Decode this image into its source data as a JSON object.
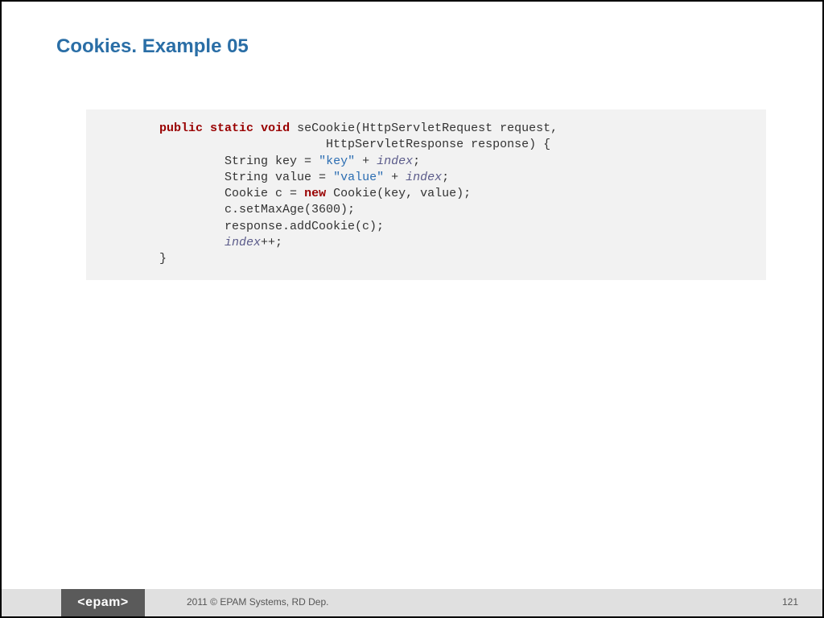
{
  "title": "Cookies. Example 05",
  "code": {
    "indent1": "         ",
    "indent2": "                  ",
    "indent3": "                                ",
    "kw_public": "public",
    "kw_static": "static",
    "kw_void": "void",
    "kw_new": "new",
    "ident_index": "index",
    "sig_part1": " seCookie(HttpServletRequest request,",
    "sig_part2": "HttpServletResponse response) {",
    "line_key_pre": "String key = ",
    "str_key": "\"key\"",
    "line_key_post": " + ",
    "semi": ";",
    "line_val_pre": "String value = ",
    "str_value": "\"value\"",
    "line_cookie_pre": "Cookie c = ",
    "line_cookie_post": " Cookie(key, value);",
    "line_maxage": "c.setMaxAge(3600);",
    "line_add": "response.addCookie(c);",
    "line_inc_post": "++;",
    "close_brace": "}"
  },
  "footer": {
    "logo": "<epam>",
    "copyright": "2011 © EPAM Systems, RD Dep.",
    "page": "121"
  }
}
